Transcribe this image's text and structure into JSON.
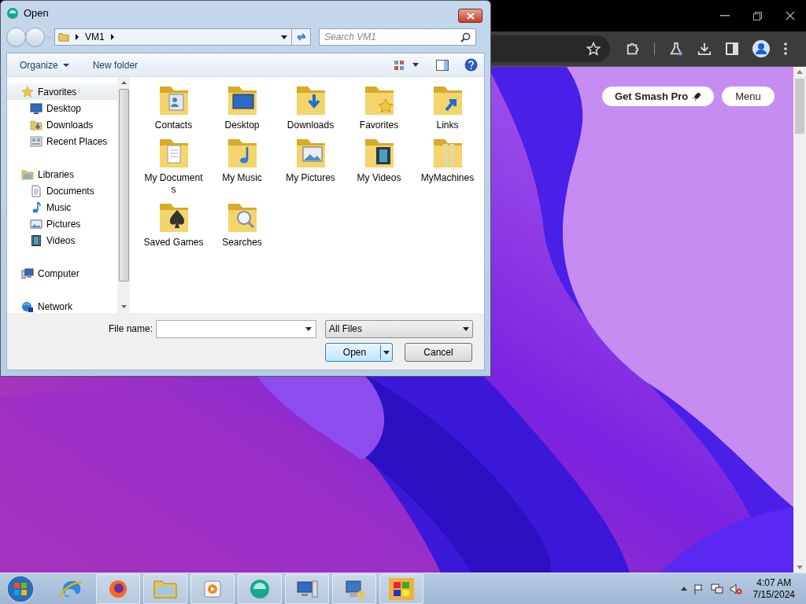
{
  "browser": {
    "page_buttons": [
      "Get Smash Pro",
      "Menu"
    ]
  },
  "dialog": {
    "title": "Open",
    "address_path": [
      "VM1"
    ],
    "search": {
      "placeholder": "Search VM1"
    },
    "toolbar": [
      "Organize",
      "New folder"
    ],
    "nav_tree": [
      {
        "label": "Favorites",
        "kind": "star",
        "selected": true,
        "children": [
          {
            "label": "Desktop",
            "kind": "desktop",
            "selected": false
          },
          {
            "label": "Downloads",
            "kind": "downloads",
            "selected": false
          },
          {
            "label": "Recent Places",
            "kind": "recent",
            "selected": false
          }
        ]
      },
      {
        "label": "Libraries",
        "kind": "libraries",
        "selected": false,
        "children": [
          {
            "label": "Documents",
            "kind": "documents",
            "selected": false
          },
          {
            "label": "Music",
            "kind": "music",
            "selected": false
          },
          {
            "label": "Pictures",
            "kind": "pictures",
            "selected": false
          },
          {
            "label": "Videos",
            "kind": "videos",
            "selected": false
          }
        ]
      },
      {
        "label": "Computer",
        "kind": "computer",
        "selected": false
      },
      {
        "label": "Network",
        "kind": "network",
        "selected": false
      }
    ],
    "files": [
      {
        "label": "Contacts",
        "kind": "contacts"
      },
      {
        "label": "Desktop",
        "kind": "desktop"
      },
      {
        "label": "Downloads",
        "kind": "downloads"
      },
      {
        "label": "Favorites",
        "kind": "star"
      },
      {
        "label": "Links",
        "kind": "links"
      },
      {
        "label": "My Documents",
        "kind": "documents"
      },
      {
        "label": "My Music",
        "kind": "music"
      },
      {
        "label": "My Pictures",
        "kind": "pictures"
      },
      {
        "label": "My Videos",
        "kind": "videos"
      },
      {
        "label": "MyMachines",
        "kind": "plain"
      },
      {
        "label": "Saved Games",
        "kind": "games"
      },
      {
        "label": "Searches",
        "kind": "search"
      }
    ],
    "file_name": {
      "label": "File name:"
    },
    "file_type": "All Files",
    "buttons": [
      "Open",
      "Cancel"
    ]
  },
  "taskbar": {
    "items": [
      {
        "kind": "ie",
        "running": false
      },
      {
        "kind": "firefox",
        "running": true
      },
      {
        "kind": "explorer",
        "running": true
      },
      {
        "kind": "media",
        "running": true
      },
      {
        "kind": "app",
        "running": true
      },
      {
        "kind": "computer",
        "running": true
      },
      {
        "kind": "network",
        "running": true
      },
      {
        "kind": "windows",
        "running": true
      }
    ],
    "time": "4:07 AM",
    "date": "7/15/2024"
  }
}
